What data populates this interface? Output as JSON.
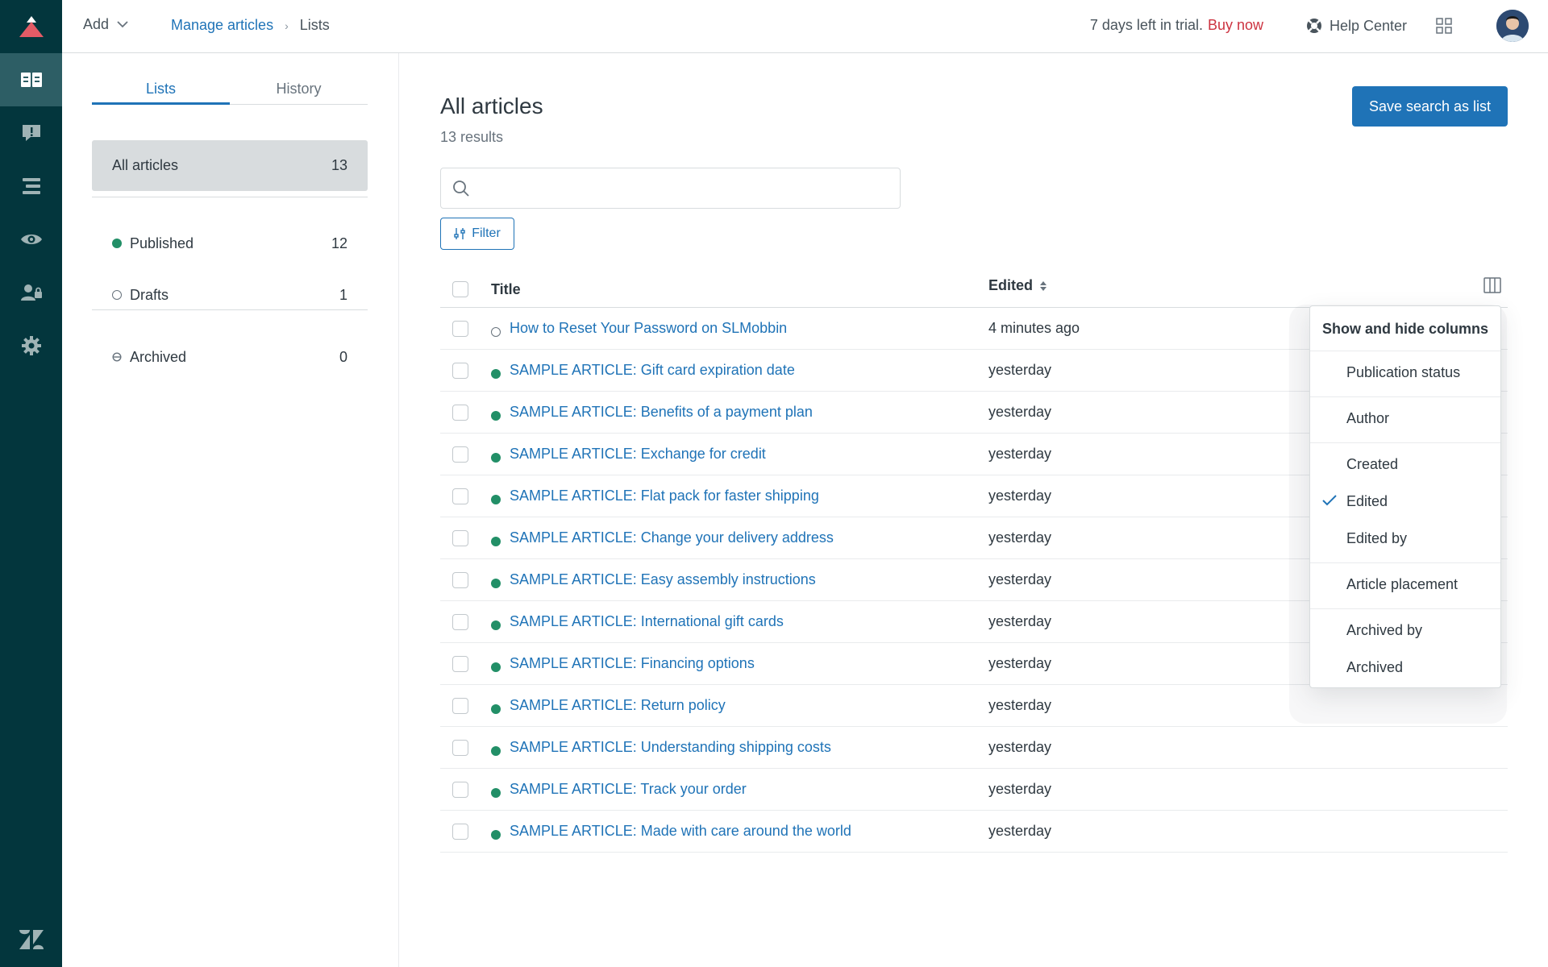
{
  "header": {
    "add_label": "Add",
    "breadcrumb": {
      "parent": "Manage articles",
      "current": "Lists"
    },
    "trial_text": "7 days left in trial.",
    "buy_now": "Buy now",
    "help_center": "Help Center"
  },
  "sidebar": {
    "tabs": [
      {
        "label": "Lists"
      },
      {
        "label": "History"
      }
    ],
    "all_articles": {
      "label": "All articles",
      "count": "13"
    },
    "lists": [
      {
        "label": "Published",
        "count": "12",
        "status": "published"
      },
      {
        "label": "Drafts",
        "count": "1",
        "status": "draft"
      },
      {
        "label": "Archived",
        "count": "0",
        "status": "archived"
      }
    ]
  },
  "main": {
    "title": "All articles",
    "results": "13 results",
    "save_button": "Save search as list",
    "search_placeholder": "",
    "filter_label": "Filter",
    "columns": {
      "title": "Title",
      "edited": "Edited"
    },
    "rows": [
      {
        "title": "How to Reset Your Password on SLMobbin",
        "edited": "4 minutes ago",
        "status": "draft"
      },
      {
        "title": "SAMPLE ARTICLE: Gift card expiration date",
        "edited": "yesterday",
        "status": "published"
      },
      {
        "title": "SAMPLE ARTICLE: Benefits of a payment plan",
        "edited": "yesterday",
        "status": "published"
      },
      {
        "title": "SAMPLE ARTICLE: Exchange for credit",
        "edited": "yesterday",
        "status": "published"
      },
      {
        "title": "SAMPLE ARTICLE: Flat pack for faster shipping",
        "edited": "yesterday",
        "status": "published"
      },
      {
        "title": "SAMPLE ARTICLE: Change your delivery address",
        "edited": "yesterday",
        "status": "published"
      },
      {
        "title": "SAMPLE ARTICLE: Easy assembly instructions",
        "edited": "yesterday",
        "status": "published"
      },
      {
        "title": "SAMPLE ARTICLE: International gift cards",
        "edited": "yesterday",
        "status": "published"
      },
      {
        "title": "SAMPLE ARTICLE: Financing options",
        "edited": "yesterday",
        "status": "published"
      },
      {
        "title": "SAMPLE ARTICLE: Return policy",
        "edited": "yesterday",
        "status": "published"
      },
      {
        "title": "SAMPLE ARTICLE: Understanding shipping costs",
        "edited": "yesterday",
        "status": "published"
      },
      {
        "title": "SAMPLE ARTICLE: Track your order",
        "edited": "yesterday",
        "status": "published"
      },
      {
        "title": "SAMPLE ARTICLE: Made with care around the world",
        "edited": "yesterday",
        "status": "published"
      }
    ]
  },
  "columns_menu": {
    "title": "Show and hide columns",
    "groups": [
      [
        {
          "label": "Publication status",
          "checked": false
        }
      ],
      [
        {
          "label": "Author",
          "checked": false
        }
      ],
      [
        {
          "label": "Created",
          "checked": false
        },
        {
          "label": "Edited",
          "checked": true
        },
        {
          "label": "Edited by",
          "checked": false
        }
      ],
      [
        {
          "label": "Article placement",
          "checked": false
        }
      ],
      [
        {
          "label": "Archived by",
          "checked": false
        },
        {
          "label": "Archived",
          "checked": false
        }
      ]
    ]
  },
  "colors": {
    "rail": "#03363d",
    "accent": "#1f73b7",
    "published": "#228f67",
    "buy_now": "#cc3340"
  },
  "icons": {
    "rail": [
      "guide-logo-icon",
      "articles-icon",
      "feedback-icon",
      "arrange-content-icon",
      "preview-icon",
      "user-permissions-icon",
      "settings-icon",
      "zendesk-icon"
    ]
  }
}
